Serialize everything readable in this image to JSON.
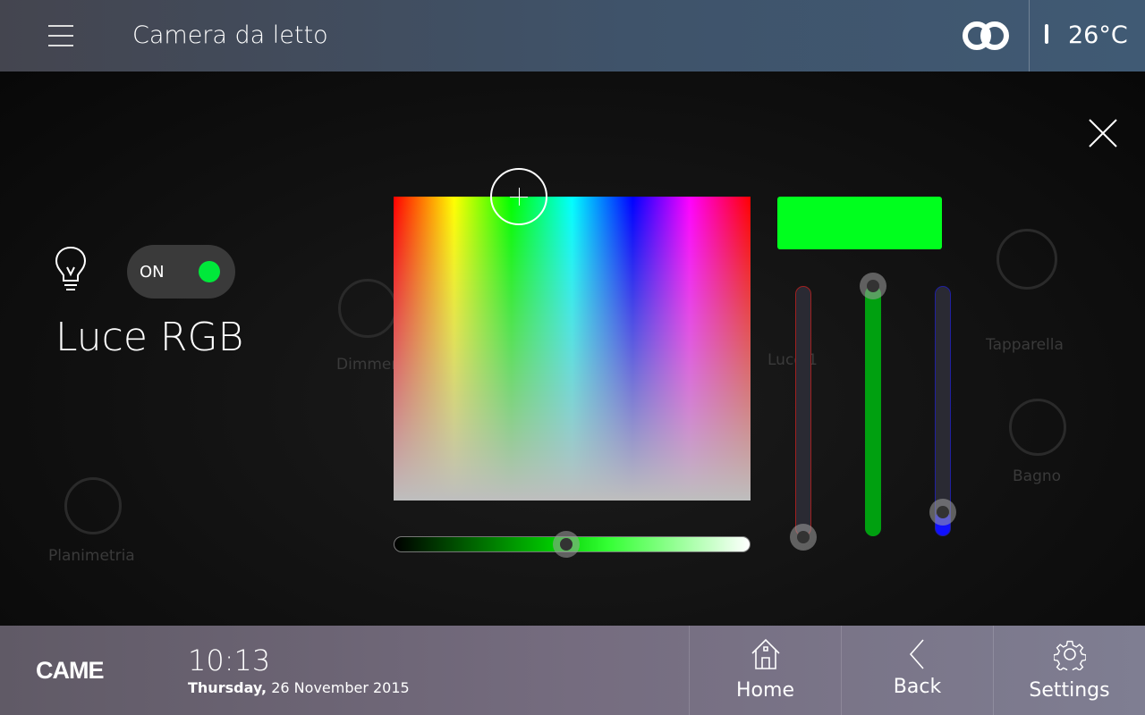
{
  "header": {
    "title": "Camera da letto",
    "temperature": "26°C",
    "icons": [
      "menu-icon",
      "cloud-link-icon",
      "thermometer-icon"
    ]
  },
  "background_labels": [
    "Dimmer",
    "Luce 1",
    "Tapparella",
    "Bagno",
    "Planimetria"
  ],
  "device": {
    "name": "Luce RGB",
    "toggle_label": "ON",
    "state": "on",
    "icon": "light-bulb-icon"
  },
  "color": {
    "selected": "#00ff1e",
    "brightness_percent": 48,
    "red_percent": 0,
    "green_percent": 100,
    "blue_percent": 10,
    "red_color": "#e01010",
    "green_color": "#00a010",
    "blue_color": "#1010ff",
    "accent": "#00e83a"
  },
  "footer": {
    "brand": "CAME",
    "time": "10:13",
    "weekday": "Thursday,",
    "date": "26 November 2015",
    "nav": [
      {
        "label": "Home",
        "icon": "home-icon"
      },
      {
        "label": "Back",
        "icon": "chevron-left-icon"
      },
      {
        "label": "Settings",
        "icon": "gear-icon"
      }
    ]
  }
}
